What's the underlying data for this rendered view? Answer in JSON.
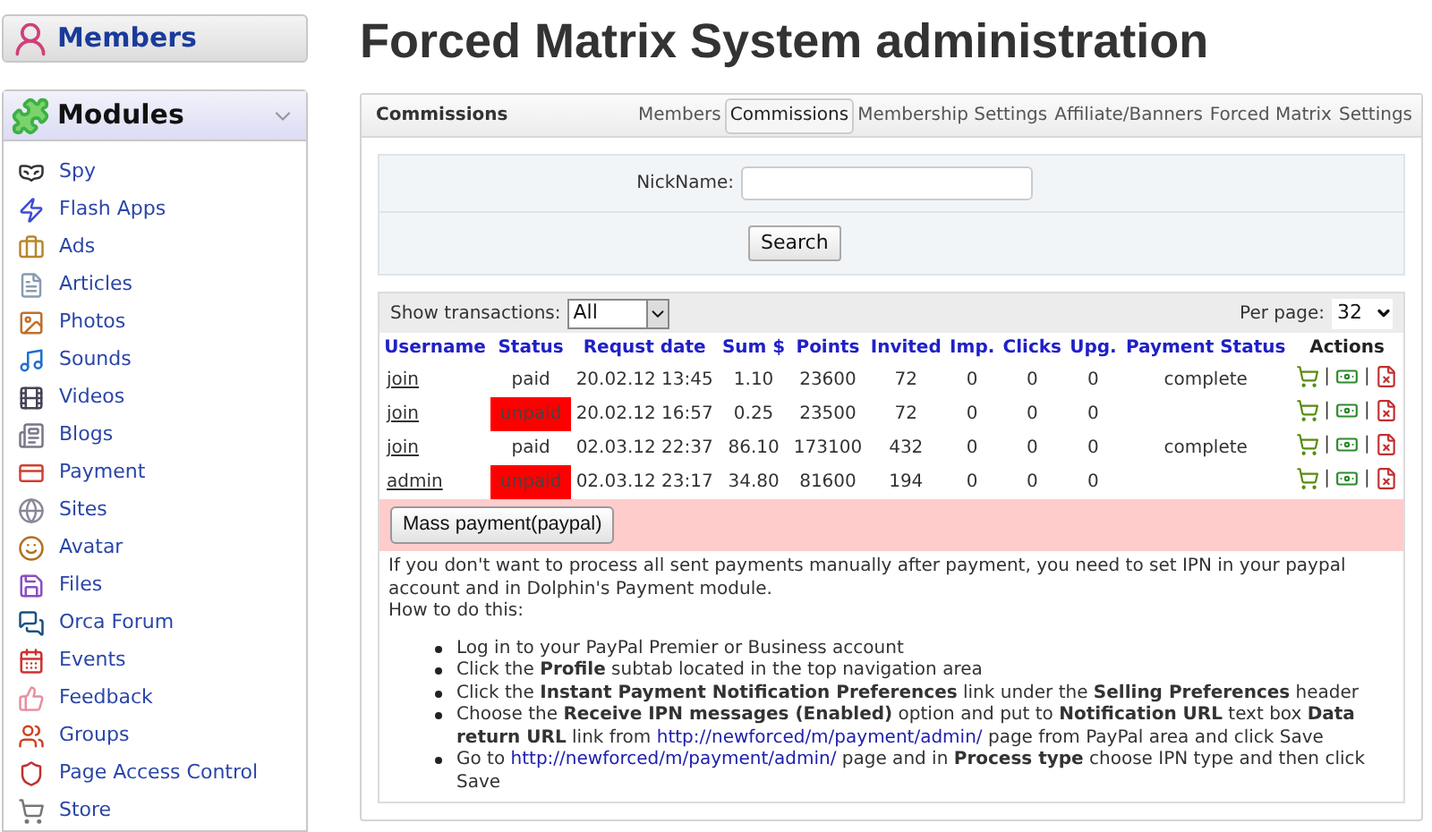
{
  "sidebar": {
    "members_title": "Members",
    "modules_title": "Modules",
    "modules_expanded": true,
    "items": [
      {
        "label": "Spy",
        "kind": "spy"
      },
      {
        "label": "Flash Apps",
        "kind": "flash"
      },
      {
        "label": "Ads",
        "kind": "ads"
      },
      {
        "label": "Articles",
        "kind": "articles"
      },
      {
        "label": "Photos",
        "kind": "photos"
      },
      {
        "label": "Sounds",
        "kind": "sounds"
      },
      {
        "label": "Videos",
        "kind": "videos"
      },
      {
        "label": "Blogs",
        "kind": "blogs"
      },
      {
        "label": "Payment",
        "kind": "payment"
      },
      {
        "label": "Sites",
        "kind": "sites"
      },
      {
        "label": "Avatar",
        "kind": "avatar"
      },
      {
        "label": "Files",
        "kind": "files"
      },
      {
        "label": "Orca Forum",
        "kind": "forum"
      },
      {
        "label": "Events",
        "kind": "events"
      },
      {
        "label": "Feedback",
        "kind": "feedback"
      },
      {
        "label": "Groups",
        "kind": "groups"
      },
      {
        "label": "Page Access Control",
        "kind": "access"
      },
      {
        "label": "Store",
        "kind": "store"
      }
    ]
  },
  "page_title": "Forced Matrix System administration",
  "panel": {
    "title": "Commissions",
    "tabs": [
      {
        "label": "Members",
        "selected": false
      },
      {
        "label": "Commissions",
        "selected": true
      },
      {
        "label": "Membership Settings",
        "selected": false
      },
      {
        "label": "Affiliate/Banners",
        "selected": false
      },
      {
        "label": "Forced Matrix",
        "selected": false
      },
      {
        "label": "Settings",
        "selected": false
      }
    ]
  },
  "search": {
    "label": "NickName:",
    "button": "Search"
  },
  "transactions": {
    "filter_label": "Show transactions:",
    "filter_value": "All",
    "per_page_label": "Per page:",
    "per_page_value": "32",
    "columns": [
      "Username",
      "Status",
      "Requst date",
      "Sum $",
      "Points",
      "Invited",
      "Imp.",
      "Clicks",
      "Upg.",
      "Payment Status",
      "Actions"
    ],
    "rows": [
      {
        "username": "join",
        "status": "paid",
        "paid": true,
        "date": "20.02.12 13:45",
        "sum": "1.10",
        "points": "23600",
        "invited": "72",
        "imp": "0",
        "clicks": "0",
        "upg": "0",
        "payment_status": "complete"
      },
      {
        "username": "join",
        "status": "unpaid",
        "paid": false,
        "date": "20.02.12 16:57",
        "sum": "0.25",
        "points": "23500",
        "invited": "72",
        "imp": "0",
        "clicks": "0",
        "upg": "0"
      },
      {
        "username": "join",
        "status": "paid",
        "paid": true,
        "date": "02.03.12 22:37",
        "sum": "86.10",
        "points": "173100",
        "invited": "432",
        "imp": "0",
        "clicks": "0",
        "upg": "0",
        "payment_status": "complete"
      },
      {
        "username": "admin",
        "status": "unpaid",
        "paid": false,
        "date": "02.03.12 23:17",
        "sum": "34.80",
        "points": "81600",
        "invited": "194",
        "imp": "0",
        "clicks": "0",
        "upg": "0"
      }
    ],
    "action_separator": "|",
    "mass_payment_button": "Mass payment(paypal)"
  },
  "instructions": {
    "intro": "If you don't want to process all sent payments manually after payment, you need to set IPN in your paypal account and in Dolphin's Payment module.",
    "how_to": "How to do this:",
    "steps": [
      {
        "text": "Log in to your PayPal Premier or Business account"
      },
      {
        "text": "Click the **Profile** subtab located in the top navigation area"
      },
      {
        "text": "Click the **Instant Payment Notification Preferences** link under the **Selling Preferences** header"
      },
      {
        "text": "Choose the **Receive IPN messages (Enabled)** option and put to **Notification URL** text box **Data return URL** link from",
        "link": "http://newforced/m/payment/admin/",
        "after": "page from PayPal area and click Save"
      },
      {
        "text": "Go to",
        "link": "http://newforced/m/payment/admin/",
        "after": "page and in **Process type** choose IPN type and then click Save"
      }
    ]
  }
}
